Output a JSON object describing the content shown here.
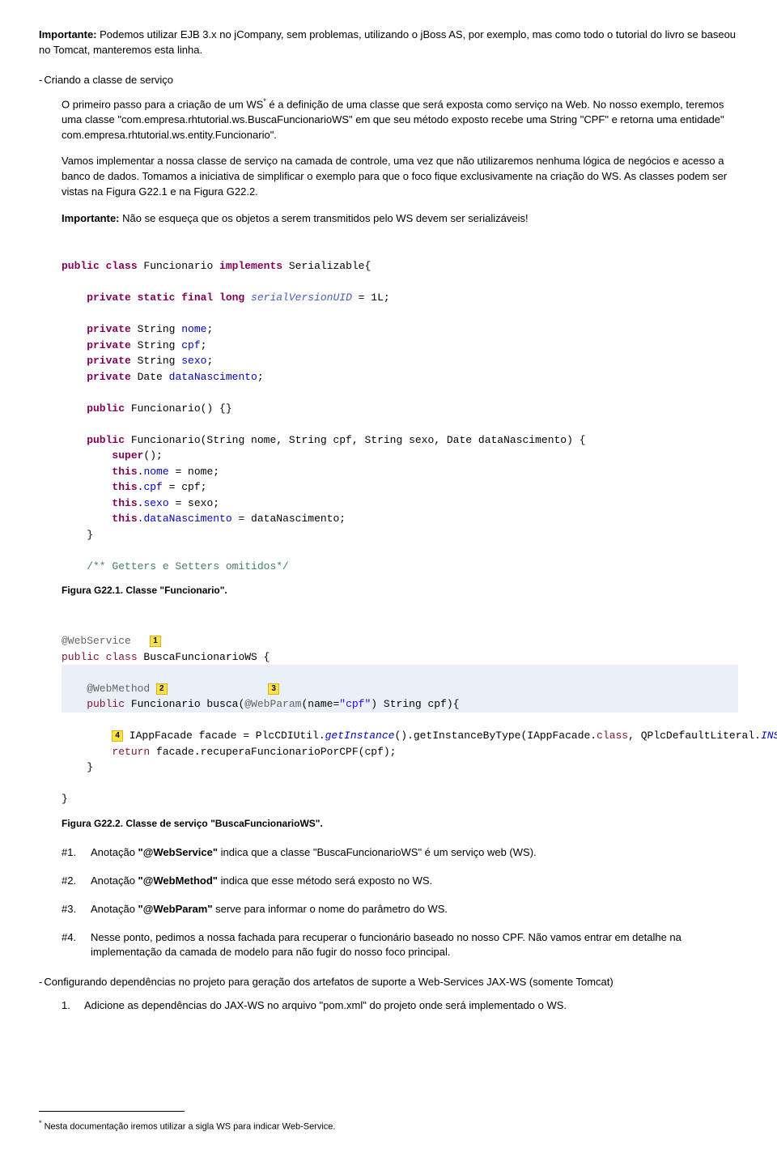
{
  "p1": {
    "label": "Importante:",
    "text": " Podemos utilizar EJB 3.x no jCompany, sem problemas, utilizando o jBoss AS, por exemplo, mas como todo o tutorial do livro se baseou no Tomcat, manteremos esta linha."
  },
  "h1": {
    "dash": "-",
    "text": "Criando a classe de serviço"
  },
  "p2": {
    "a": "O primeiro passo para a criação de um WS",
    "sup": "*",
    "b": " é a definição de uma classe que será exposta como serviço na Web. No nosso exemplo, teremos uma classe \"com.empresa.rhtutorial.ws.BuscaFuncionarioWS\" em que seu método exposto recebe uma String \"CPF\" e retorna uma entidade\" com.empresa.rhtutorial.ws.entity.Funcionario\"."
  },
  "p3": "Vamos implementar a nossa classe de serviço na camada de controle, uma vez que não utilizaremos nenhuma lógica de negócios e acesso a banco de dados. Tomamos a iniciativa de simplificar o exemplo para que o foco fique exclusivamente na criação do WS. As classes podem ser vistas na Figura G22.1 e na Figura G22.2.",
  "p4": {
    "label": "Importante:",
    "text": " Não se esqueça que os objetos a serem transmitidos pelo WS devem ser serializáveis!"
  },
  "code1": {
    "l1a": "public class",
    "l1b": " Funcionario ",
    "l1c": "implements",
    "l1d": " Serializable{",
    "l2a": "    private static final long",
    "l2b": " serialVersionUID",
    "l2c": " = 1L;",
    "l3a": "    private",
    "l3b": " String ",
    "l3c": "nome",
    "l3d": ";",
    "l4a": "    private",
    "l4b": " String ",
    "l4c": "cpf",
    "l4d": ";",
    "l5a": "    private",
    "l5b": " String ",
    "l5c": "sexo",
    "l5d": ";",
    "l6a": "    private",
    "l6b": " Date ",
    "l6c": "dataNascimento",
    "l6d": ";",
    "l7a": "    public",
    "l7b": " Funcionario() {}",
    "l8a": "    public",
    "l8b": " Funcionario(String nome, String cpf, String sexo, Date dataNascimento) {",
    "l9a": "        super",
    "l9b": "();",
    "l10a": "        this",
    "l10b": ".",
    "l10c": "nome",
    "l10d": " = nome;",
    "l11a": "        this",
    "l11b": ".",
    "l11c": "cpf",
    "l11d": " = cpf;",
    "l12a": "        this",
    "l12b": ".",
    "l12c": "sexo",
    "l12d": " = sexo;",
    "l13a": "        this",
    "l13b": ".",
    "l13c": "dataNascimento",
    "l13d": " = dataNascimento;",
    "l14": "    }",
    "l15": "    /** Getters e Setters omitidos*/"
  },
  "cap1": "Figura G22.1. Classe \"Funcionario\".",
  "code2": {
    "l1a": "@WebService",
    "b1": "1",
    "l2a": "public class",
    "l2b": " BuscaFuncionarioWS {",
    "l3a": "    @WebMethod",
    "b2": "2",
    "l4a": "    public",
    "l4b": " Funcionario busca(",
    "l4c": "@WebParam",
    "l4d": "(name=",
    "l4e": "\"cpf\"",
    "l4f": ") String cpf){",
    "b3": "3",
    "l5a": "        ",
    "b4": "4",
    "l5b": " IAppFacade facade = PlcCDIUtil.",
    "l5c": "getInstance",
    "l5d": "().getInstanceByType(IAppFacade.",
    "l5e": "class",
    "l5f": ", QPlcDefaultLiteral.",
    "l5g": "INSTANCE",
    "l5h": ");",
    "l6a": "        return",
    "l6b": " facade.recuperaFuncionarioPorCPF(cpf);",
    "l7": "    }",
    "l8": "}"
  },
  "cap2": "Figura G22.2. Classe de serviço \"BuscaFuncionarioWS\".",
  "items": [
    {
      "num": "#1.",
      "pre": "Anotação ",
      "bold": "\"@WebService\"",
      "post": " indica que a classe \"BuscaFuncionarioWS\" é um serviço web (WS)."
    },
    {
      "num": "#2.",
      "pre": "Anotação ",
      "bold": "\"@WebMethod\"",
      "post": " indica que esse método será exposto no WS."
    },
    {
      "num": "#3.",
      "pre": "Anotação ",
      "bold": "\"@WebParam\"",
      "post": " serve para informar o nome do parâmetro do WS."
    },
    {
      "num": "#4.",
      "pre": "",
      "bold": "",
      "post": "Nesse ponto, pedimos a nossa fachada para recuperar o funcionário baseado no nosso CPF. Não vamos entrar em detalhe na implementação da camada de modelo para não fugir do nosso foco principal."
    }
  ],
  "h2": {
    "dash": "-",
    "text": "Configurando dependências no projeto para geração dos artefatos de suporte a Web-Services JAX-WS (somente Tomcat)"
  },
  "ol": [
    {
      "num": "1.",
      "text": "Adicione as dependências do JAX-WS no arquivo \"pom.xml\" do projeto onde será implementado o WS."
    }
  ],
  "footnote": {
    "sup": "*",
    "text": " Nesta documentação iremos utilizar a sigla WS para indicar Web-Service."
  }
}
